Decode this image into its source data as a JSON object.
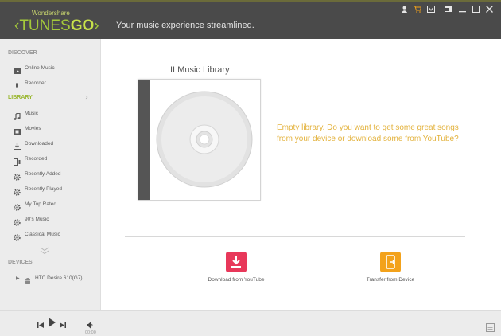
{
  "app": {
    "brand": "Wondershare",
    "name_prefix": "TUNES",
    "name_suffix": "GO",
    "tagline": "Your music experience streamlined."
  },
  "header_icons": [
    "user-icon",
    "cart-icon",
    "feedback-icon",
    "mini-player-icon",
    "minimize-icon",
    "maximize-icon",
    "close-icon"
  ],
  "sidebar": {
    "discover_title": "DISCOVER",
    "discover_items": [
      {
        "label": "Online Music",
        "icon": "youtube-icon"
      },
      {
        "label": "Recorder",
        "icon": "microphone-icon"
      }
    ],
    "library_title": "LIBRARY",
    "library_items": [
      {
        "label": "Music",
        "icon": "music-note-icon"
      },
      {
        "label": "Movies",
        "icon": "film-icon"
      },
      {
        "label": "Downloaded",
        "icon": "download-icon"
      },
      {
        "label": "Recorded",
        "icon": "recorded-icon"
      },
      {
        "label": "Recently Added",
        "icon": "gear-icon"
      },
      {
        "label": "Recently Played",
        "icon": "gear-icon"
      },
      {
        "label": "My Top Rated",
        "icon": "gear-icon"
      },
      {
        "label": "90's Music",
        "icon": "gear-icon"
      },
      {
        "label": "Classical Music",
        "icon": "gear-icon"
      }
    ],
    "devices_title": "DEVICES",
    "device_label": "HTC Desire 610(G7)"
  },
  "main": {
    "library_title": "II Music Library",
    "empty_message": "Empty library. Do you want to get some great songs from your device or download some from YouTube?",
    "actions": [
      {
        "label": "Download from YouTube",
        "color": "#e8385a"
      },
      {
        "label": "Transfer from Device",
        "color": "#f3a21b"
      }
    ]
  },
  "player": {
    "time": "00:00"
  },
  "colors": {
    "header_bg": "#4a4a4a",
    "accent_green": "#9ab730",
    "message_yellow": "#e3b23c",
    "sidebar_bg": "#ececec"
  }
}
